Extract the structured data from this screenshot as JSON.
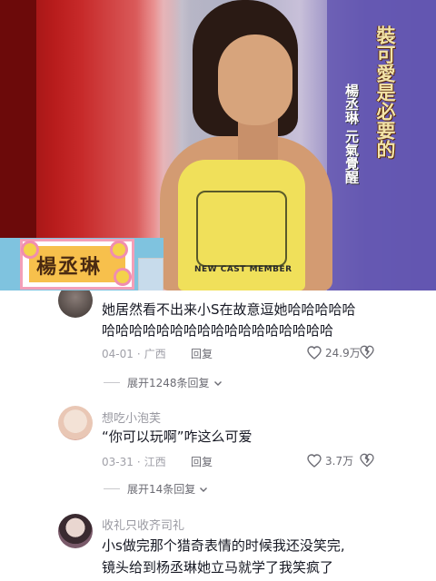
{
  "video": {
    "caption_main": "裝可愛是必要的",
    "caption_sub": "楊丞琳 元氣覺醒",
    "name_sign": "楊丞琳",
    "shirt_text": "NEW CAST MEMBER"
  },
  "comments": [
    {
      "username": "",
      "text_lines": [
        "她居然看不出来小S在故意逗她哈哈哈哈哈",
        "哈哈哈哈哈哈哈哈哈哈哈哈哈哈哈哈哈"
      ],
      "date": "04-01",
      "location": "广西",
      "reply_label": "回复",
      "likes": "24.9万",
      "expand_label": "展开1248条回复"
    },
    {
      "username": "想吃小泡芙",
      "text_lines": [
        "“你可以玩啊”咋这么可爱"
      ],
      "date": "03-31",
      "location": "江西",
      "reply_label": "回复",
      "likes": "3.7万",
      "expand_label": "展开14条回复"
    },
    {
      "username": "收礼只收齐司礼",
      "text_lines": [
        "小s做完那个猎奇表情的时候我还没笑完,",
        "镜头给到杨丞琳她立马就学了我笑疯了"
      ],
      "date": "",
      "location": "",
      "reply_label": "",
      "likes": "",
      "expand_label": ""
    }
  ],
  "colors": {
    "text": "#161823",
    "secondary": "#9a9aa2",
    "background": "#ffffff"
  },
  "icons": [
    "heart-icon",
    "dislike-icon",
    "chevron-down-icon"
  ]
}
